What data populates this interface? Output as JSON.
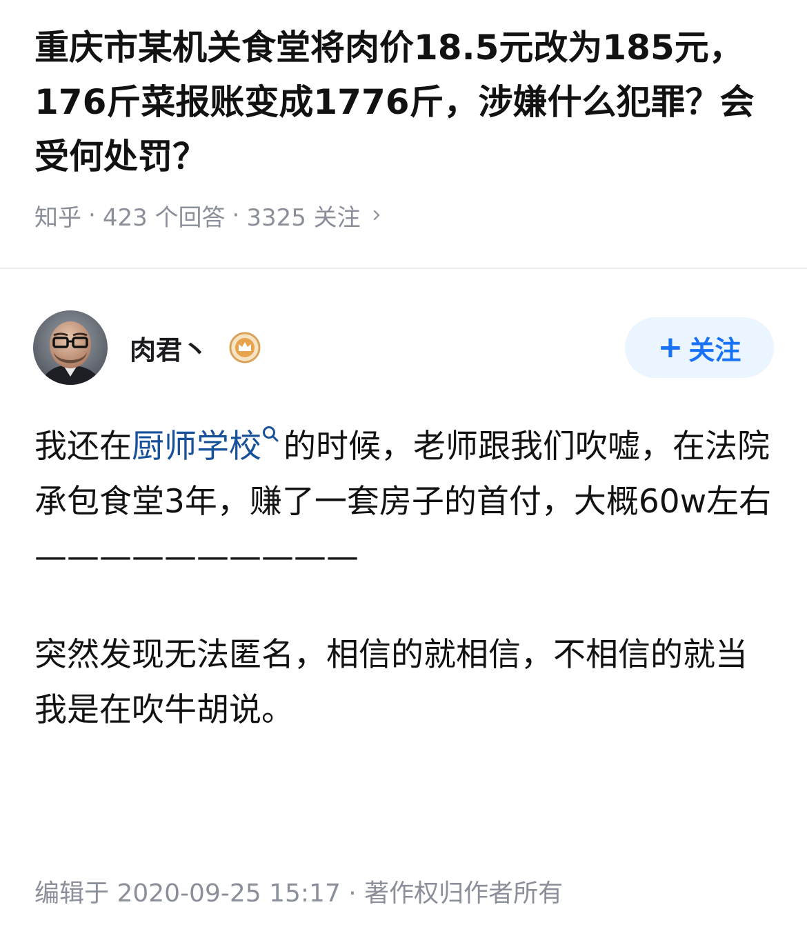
{
  "question": {
    "title": "重庆市某机关食堂将肉价18.5元改为185元，176斤菜报账变成1776斤，涉嫌什么犯罪？会受何处罚？",
    "source": "知乎",
    "answers": "423 个回答",
    "followers": "3325 关注",
    "separator": "·"
  },
  "author": {
    "name": "肉君丶",
    "avatar_icon": "avatar-man-glasses",
    "badge_icon": "crown-badge-icon",
    "follow_label": "关注",
    "follow_plus": "+"
  },
  "answer": {
    "p1_before": "我还在",
    "p1_link": "厨师学校",
    "p1_after": "的时候，老师跟我们吹嘘，在法院承包食堂3年，赚了一套房子的首付，大概60w左右",
    "rule": "——————————",
    "p2": "突然发现无法匿名，相信的就相信，不相信的就当我是在吹牛胡说。",
    "footer": "编辑于 2020-09-25 15:17 · 著作权归作者所有"
  },
  "colors": {
    "link": "#175199",
    "follow_text": "#1772f6",
    "follow_bg": "#ebf5ff",
    "meta": "#8a8f99"
  }
}
